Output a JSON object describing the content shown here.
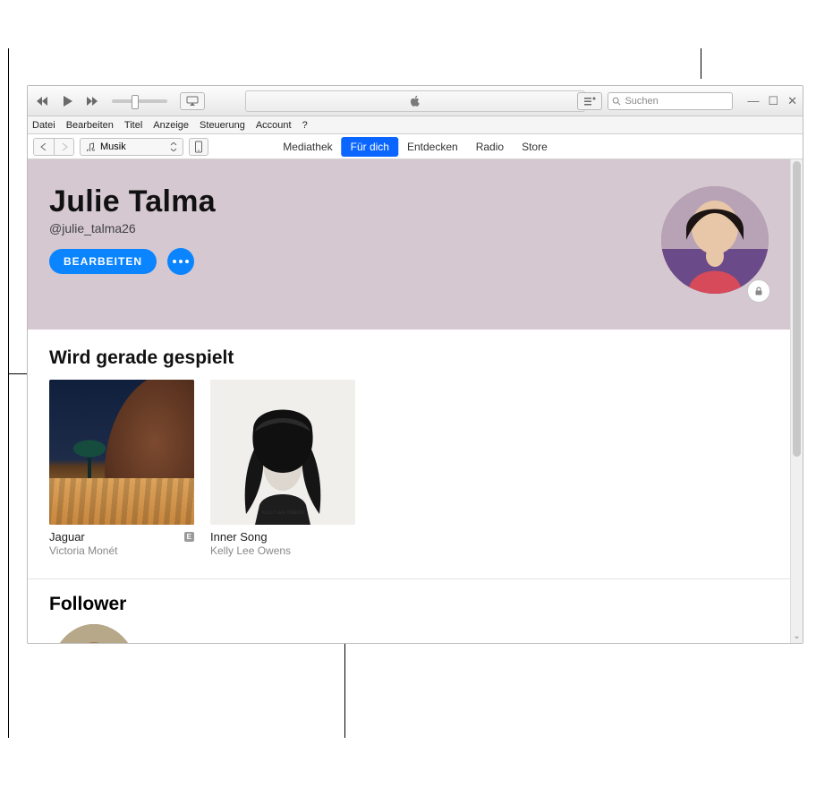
{
  "titlebar": {
    "search_placeholder": "Suchen"
  },
  "menubar": {
    "items": [
      "Datei",
      "Bearbeiten",
      "Titel",
      "Anzeige",
      "Steuerung",
      "Account",
      "?"
    ]
  },
  "toolbar": {
    "media_selector": "Musik",
    "tabs": [
      "Mediathek",
      "Für dich",
      "Entdecken",
      "Radio",
      "Store"
    ],
    "active_tab_index": 1
  },
  "profile": {
    "name": "Julie Talma",
    "handle": "@julie_talma26",
    "edit_label": "BEARBEITEN"
  },
  "now_playing": {
    "heading": "Wird gerade gespielt",
    "albums": [
      {
        "title": "Jaguar",
        "artist": "Victoria Monét",
        "explicit_badge": "E"
      },
      {
        "title": "Inner Song",
        "artist": "Kelly Lee Owens"
      }
    ]
  },
  "followers": {
    "heading": "Follower"
  }
}
